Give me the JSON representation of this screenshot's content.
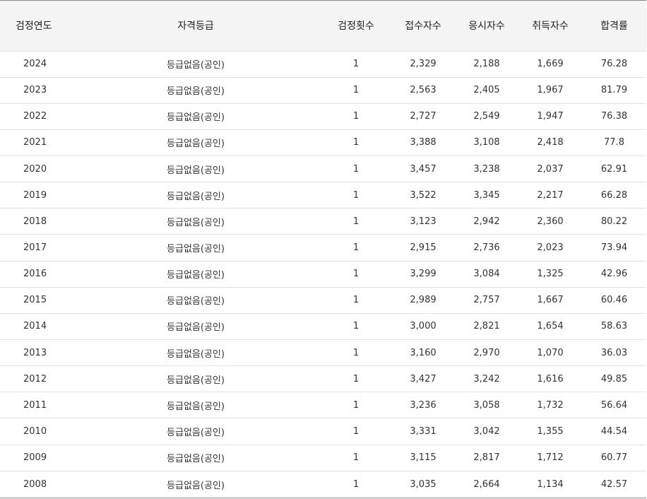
{
  "table": {
    "headers": [
      "검정연도",
      "자격등급",
      "검정횟수",
      "접수자수",
      "응시자수",
      "취득자수",
      "합격률"
    ],
    "rows": [
      [
        "2024",
        "등급없음(공인)",
        "1",
        "2,329",
        "2,188",
        "1,669",
        "76.28"
      ],
      [
        "2023",
        "등급없음(공인)",
        "1",
        "2,563",
        "2,405",
        "1,967",
        "81.79"
      ],
      [
        "2022",
        "등급없음(공인)",
        "1",
        "2,727",
        "2,549",
        "1,947",
        "76.38"
      ],
      [
        "2021",
        "등급없음(공인)",
        "1",
        "3,388",
        "3,108",
        "2,418",
        "77.8"
      ],
      [
        "2020",
        "등급없음(공인)",
        "1",
        "3,457",
        "3,238",
        "2,037",
        "62.91"
      ],
      [
        "2019",
        "등급없음(공인)",
        "1",
        "3,522",
        "3,345",
        "2,217",
        "66.28"
      ],
      [
        "2018",
        "등급없음(공인)",
        "1",
        "3,123",
        "2,942",
        "2,360",
        "80.22"
      ],
      [
        "2017",
        "등급없음(공인)",
        "1",
        "2,915",
        "2,736",
        "2,023",
        "73.94"
      ],
      [
        "2016",
        "등급없음(공인)",
        "1",
        "3,299",
        "3,084",
        "1,325",
        "42.96"
      ],
      [
        "2015",
        "등급없음(공인)",
        "1",
        "2,989",
        "2,757",
        "1,667",
        "60.46"
      ],
      [
        "2014",
        "등급없음(공인)",
        "1",
        "3,000",
        "2,821",
        "1,654",
        "58.63"
      ],
      [
        "2013",
        "등급없음(공인)",
        "1",
        "3,160",
        "2,970",
        "1,070",
        "36.03"
      ],
      [
        "2012",
        "등급없음(공인)",
        "1",
        "3,427",
        "3,242",
        "1,616",
        "49.85"
      ],
      [
        "2011",
        "등급없음(공인)",
        "1",
        "3,236",
        "3,058",
        "1,732",
        "56.64"
      ],
      [
        "2010",
        "등급없음(공인)",
        "1",
        "3,331",
        "3,042",
        "1,355",
        "44.54"
      ],
      [
        "2009",
        "등급없음(공인)",
        "1",
        "3,115",
        "2,817",
        "1,712",
        "60.77"
      ],
      [
        "2008",
        "등급없음(공인)",
        "1",
        "3,035",
        "2,664",
        "1,134",
        "42.57"
      ]
    ]
  }
}
